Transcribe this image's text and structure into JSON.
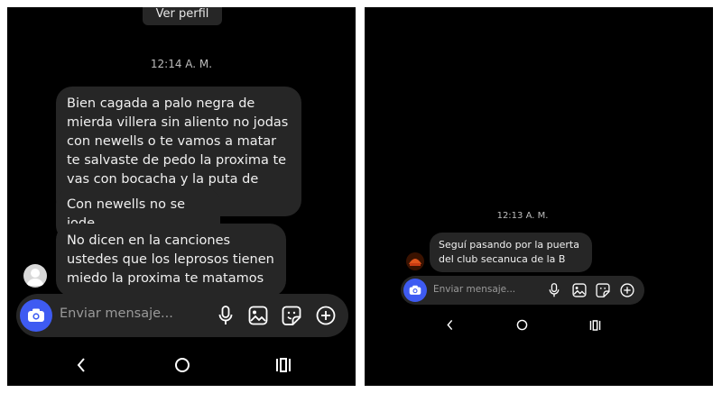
{
  "left": {
    "profile_button": "Ver perfil",
    "timestamp": "12:14 A. M.",
    "messages": [
      {
        "text": "Bien cagada a palo negra de mierda villera sin aliento no jodas con newells o te vamos a matar te salvaste de pedo la proxima te vas con bocacha y la puta de ivana"
      },
      {
        "text": "Con newells no se jode"
      },
      {
        "text": "No dicen en la canciones ustedes que los leprosos tienen miedo la proxima te matamos"
      }
    ],
    "composer": {
      "placeholder": "Enviar mensaje..."
    },
    "icons": [
      "camera-icon",
      "microphone-icon",
      "image-icon",
      "sticker-icon",
      "plus-icon"
    ],
    "nav": [
      "back-icon",
      "home-icon",
      "recents-icon"
    ]
  },
  "right": {
    "timestamp": "12:13 A. M.",
    "messages": [
      {
        "text": "Seguí pasando por la puerta del club secanuca de la B"
      }
    ],
    "composer": {
      "placeholder": "Enviar mensaje..."
    },
    "icons": [
      "camera-icon",
      "microphone-icon",
      "image-icon",
      "sticker-icon",
      "plus-icon"
    ],
    "nav": [
      "back-icon",
      "home-icon",
      "recents-icon"
    ]
  },
  "colors": {
    "background": "#000000",
    "bubble": "#262626",
    "camera_button": "#3e5bf2",
    "placeholder": "#9a9a9a",
    "timestamp": "#bdbdbd"
  }
}
